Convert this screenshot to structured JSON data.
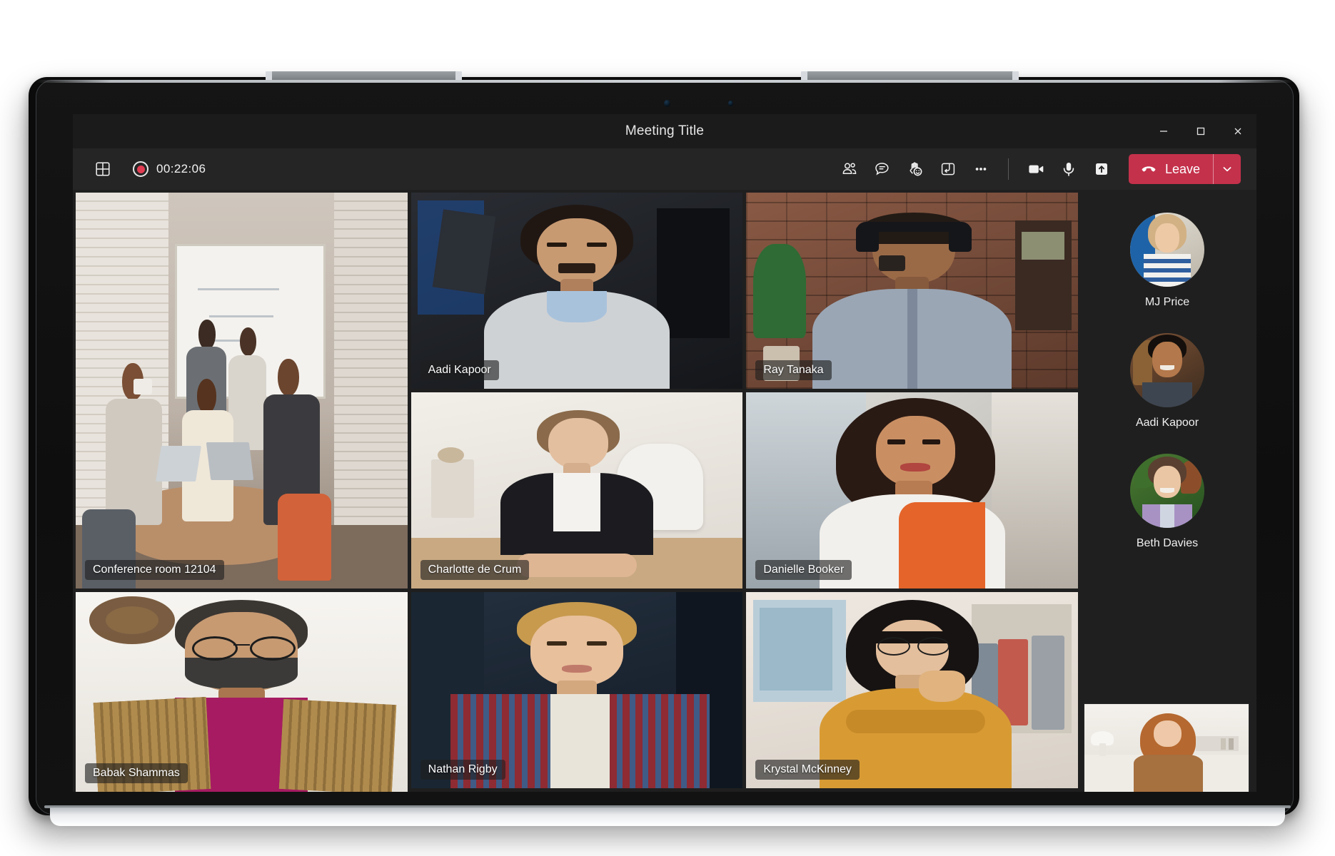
{
  "window": {
    "title": "Meeting Title",
    "controls": [
      {
        "name": "minimize",
        "glyph": "minimize-icon"
      },
      {
        "name": "maximize",
        "glyph": "maximize-icon"
      },
      {
        "name": "close",
        "glyph": "close-icon"
      }
    ]
  },
  "toolbar": {
    "layout_icon": "grid-layout-icon",
    "recording": {
      "icon": "record-dot-icon",
      "elapsed": "00:22:06"
    },
    "actions": [
      {
        "name": "people",
        "icon": "people-icon",
        "label": "Show participants"
      },
      {
        "name": "chat",
        "icon": "chat-bubble-icon",
        "label": "Show conversation"
      },
      {
        "name": "reactions",
        "icon": "raise-hand-reactions-icon",
        "label": "Reactions"
      },
      {
        "name": "breakout-rooms",
        "icon": "breakout-rooms-icon",
        "label": "Breakout rooms"
      },
      {
        "name": "more",
        "icon": "more-ellipsis-icon",
        "label": "More actions"
      }
    ],
    "media": [
      {
        "name": "camera",
        "icon": "camera-icon",
        "label": "Camera",
        "state": "on"
      },
      {
        "name": "microphone",
        "icon": "microphone-icon",
        "label": "Mic",
        "state": "on"
      },
      {
        "name": "share",
        "icon": "share-screen-icon",
        "label": "Share content"
      }
    ],
    "leave": {
      "label": "Leave",
      "icon": "hangup-phone-icon",
      "caret_icon": "chevron-down-icon",
      "color": "#C4314B"
    }
  },
  "grid": {
    "tiles": [
      {
        "name": "conference-room-12104",
        "label": "Conference room 12104",
        "scene": "conference-room",
        "span": "big"
      },
      {
        "name": "aadi-kapoor",
        "label": "Aadi Kapoor",
        "scene": "aadi"
      },
      {
        "name": "ray-tanaka",
        "label": "Ray Tanaka",
        "scene": "ray"
      },
      {
        "name": "charlotte-de-crum",
        "label": "Charlotte de Crum",
        "scene": "charlotte"
      },
      {
        "name": "danielle-booker",
        "label": "Danielle Booker",
        "scene": "danielle"
      },
      {
        "name": "babak-shammas",
        "label": "Babak Shammas",
        "scene": "babak",
        "span": "big"
      },
      {
        "name": "nathan-rigby",
        "label": "Nathan Rigby",
        "scene": "nathan"
      },
      {
        "name": "krystal-mckinney",
        "label": "Krystal McKinney",
        "scene": "krystal"
      }
    ]
  },
  "roster": {
    "participants": [
      {
        "name": "mj-price",
        "label": "MJ Price",
        "scene": "mj"
      },
      {
        "name": "aadi-kapoor",
        "label": "Aadi Kapoor",
        "scene": "aadi_av"
      },
      {
        "name": "beth-davies",
        "label": "Beth Davies",
        "scene": "beth"
      }
    ],
    "self_view": {
      "name": "self-view",
      "label": "",
      "scene": "self"
    }
  },
  "theme": {
    "app_background": "#1F1F1F",
    "toolbar_background": "#252525",
    "titlebar_background": "#1B1B1B",
    "accent_leave": "#C4314B",
    "record_red": "#E03C52",
    "text_primary": "#F0F0F0"
  }
}
